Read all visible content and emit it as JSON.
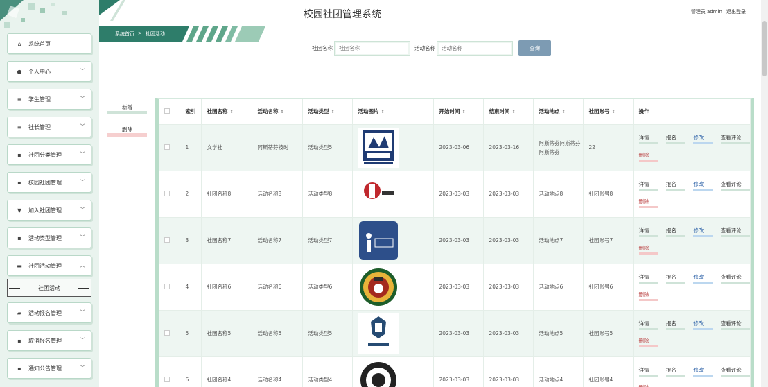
{
  "app": {
    "title": "校园社团管理系统"
  },
  "user": {
    "role_name": "管理员 admin",
    "logout": "退出登录"
  },
  "breadcrumb": {
    "home": "系统首页",
    "sep": ">",
    "current": "社团活动"
  },
  "sidebar": {
    "items": [
      {
        "label": "系统首页",
        "icon": "home-icon",
        "glyph": "⌂",
        "has_chevron": false
      },
      {
        "label": "个人中心",
        "icon": "person-icon",
        "glyph": "●",
        "has_chevron": true
      },
      {
        "label": "学生管理",
        "icon": "list-icon",
        "glyph": "≡",
        "has_chevron": true
      },
      {
        "label": "社长管理",
        "icon": "list-icon",
        "glyph": "≡",
        "has_chevron": true
      },
      {
        "label": "社团分类管理",
        "icon": "grid-icon",
        "glyph": "▪",
        "has_chevron": true
      },
      {
        "label": "校园社团管理",
        "icon": "grid-icon",
        "glyph": "▪",
        "has_chevron": true
      },
      {
        "label": "加入社团管理",
        "icon": "pin-icon",
        "glyph": "▼",
        "has_chevron": true
      },
      {
        "label": "活动类型管理",
        "icon": "grid-icon",
        "glyph": "▪",
        "has_chevron": true
      },
      {
        "label": "社团活动管理",
        "icon": "doc-icon",
        "glyph": "▬",
        "has_chevron": true,
        "expanded": true
      },
      {
        "label": "活动报名管理",
        "icon": "folder-icon",
        "glyph": "▰",
        "has_chevron": true
      },
      {
        "label": "取消报名管理",
        "icon": "grid-icon",
        "glyph": "▪",
        "has_chevron": true
      },
      {
        "label": "通知公告管理",
        "icon": "grid-icon",
        "glyph": "▪",
        "has_chevron": true
      }
    ],
    "sub_item": "社团活动"
  },
  "search": {
    "club_label": "社团名称",
    "club_placeholder": "社团名称",
    "activity_label": "活动名称",
    "activity_placeholder": "活动名称",
    "button": "查询"
  },
  "actions": {
    "add": "新增",
    "delete": "删除"
  },
  "table": {
    "headers": [
      "索引",
      "社团名称",
      "活动名称",
      "活动类型",
      "活动图片",
      "开始时间",
      "结束时间",
      "活动地点",
      "社团账号",
      "操作"
    ],
    "ops": {
      "detail": "详情",
      "signup": "报名",
      "edit": "修改",
      "comments": "查看评论",
      "delete": "删除"
    },
    "rows": [
      {
        "index": "1",
        "club": "文学社",
        "activity": "阿斯蒂芬按时",
        "type": "活动类型5",
        "image": "poetry-society-logo",
        "start": "2023-03-06",
        "end": "2023-03-16",
        "location": "阿斯蒂芬阿斯蒂芬阿斯蒂芬",
        "account": "22"
      },
      {
        "index": "2",
        "club": "社团名称8",
        "activity": "活动名称8",
        "type": "活动类型8",
        "image": "calligraphy-club-logo",
        "start": "2023-03-03",
        "end": "2023-03-03",
        "location": "活动地点8",
        "account": "社团账号8"
      },
      {
        "index": "3",
        "club": "社团名称7",
        "activity": "活动名称7",
        "type": "活动类型7",
        "image": "info-club-logo",
        "start": "2023-03-03",
        "end": "2023-03-03",
        "location": "活动地点7",
        "account": "社团账号7"
      },
      {
        "index": "4",
        "club": "社团名称6",
        "activity": "活动名称6",
        "type": "活动类型6",
        "image": "football-club-logo",
        "start": "2023-03-03",
        "end": "2023-03-03",
        "location": "活动地点6",
        "account": "社团账号6"
      },
      {
        "index": "5",
        "club": "社团名称5",
        "activity": "活动名称5",
        "type": "活动类型5",
        "image": "chess-club-logo",
        "start": "2023-03-03",
        "end": "2023-03-03",
        "location": "活动地点5",
        "account": "社团账号5"
      },
      {
        "index": "6",
        "club": "社团名称4",
        "activity": "活动名称4",
        "type": "活动类型4",
        "image": "emblem-logo",
        "start": "2023-03-03",
        "end": "2023-03-03",
        "location": "活动地点4",
        "account": "社团账号4"
      }
    ]
  },
  "colors": {
    "accent_green": "#2e8b6a",
    "sidebar_bg": "#e9f3ee",
    "search_button": "#7d9bb3"
  }
}
